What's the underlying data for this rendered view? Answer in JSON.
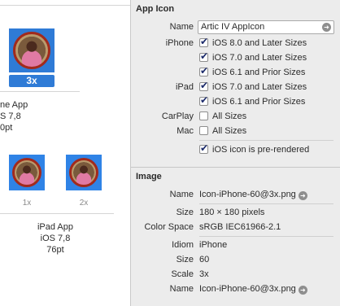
{
  "left_pane": {
    "selected_slot": {
      "scale": "3x"
    },
    "iphone_caption": {
      "line1": "ne App",
      "line2": "S 7,8",
      "line3": "0pt"
    },
    "ipad_slots": [
      {
        "scale": "1x"
      },
      {
        "scale": "2x"
      }
    ],
    "ipad_caption": {
      "line1": "iPad App",
      "line2": "iOS 7,8",
      "line3": "76pt"
    }
  },
  "inspector": {
    "app_icon_section": {
      "title": "App Icon",
      "name_label": "Name",
      "name_value": "Artic IV AppIcon",
      "iphone_label": "iPhone",
      "iphone_options": [
        {
          "label": "iOS 8.0 and Later Sizes",
          "checked": true
        },
        {
          "label": "iOS 7.0 and Later Sizes",
          "checked": true
        },
        {
          "label": "iOS 6.1 and Prior Sizes",
          "checked": true
        }
      ],
      "ipad_label": "iPad",
      "ipad_options": [
        {
          "label": "iOS 7.0 and Later Sizes",
          "checked": true
        },
        {
          "label": "iOS 6.1 and Prior Sizes",
          "checked": true
        }
      ],
      "carplay_label": "CarPlay",
      "carplay_option": {
        "label": "All Sizes",
        "checked": false
      },
      "mac_label": "Mac",
      "mac_option": {
        "label": "All Sizes",
        "checked": false
      },
      "prerendered": {
        "label": "iOS icon is pre-rendered",
        "checked": true
      }
    },
    "image_section": {
      "title": "Image",
      "name_label": "Name",
      "name_value": "Icon-iPhone-60@3x.png",
      "size_label": "Size",
      "size_value": "180 × 180 pixels",
      "colorspace_label": "Color Space",
      "colorspace_value": "sRGB IEC61966-2.1",
      "idiom_label": "Idiom",
      "idiom_value": "iPhone",
      "pt_size_label": "Size",
      "pt_size_value": "60",
      "scale_label": "Scale",
      "scale_value": "3x",
      "file_label": "Name",
      "file_value": "Icon-iPhone-60@3x.png"
    }
  },
  "colors": {
    "selection_blue": "#2f7bd6",
    "icon_bg_blue": "#2f83e6",
    "inspector_bg": "#ececec",
    "checkbox_check": "#1b2a6b"
  }
}
